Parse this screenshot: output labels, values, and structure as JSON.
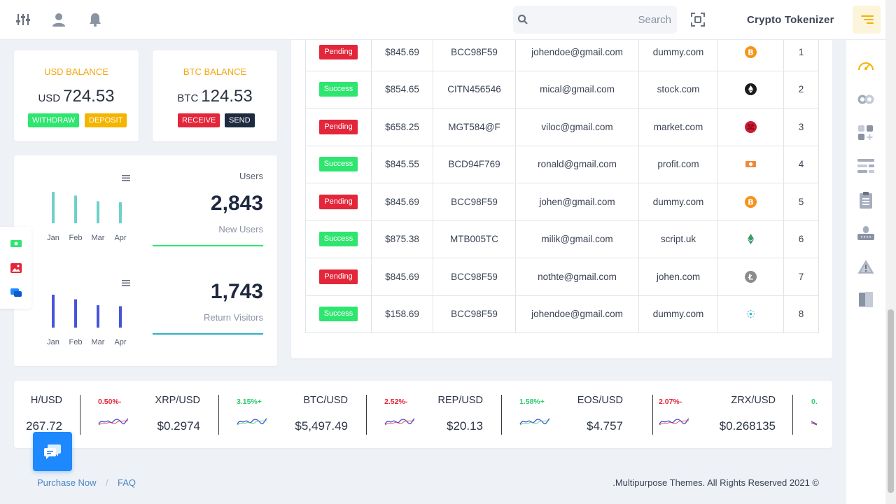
{
  "header": {
    "brand": "Crypto Tokenizer",
    "search_placeholder": "Search",
    "icons": [
      "sliders-icon",
      "user-icon",
      "bell-icon",
      "scan-icon",
      "hamburger-icon"
    ]
  },
  "balances": {
    "usd": {
      "title": "USD BALANCE",
      "currency": "USD",
      "amount": "724.53",
      "btn1": "WITHDRAW",
      "btn2": "DEPOSIT"
    },
    "btc": {
      "title": "BTC BALANCE",
      "currency": "BTC",
      "amount": "124.53",
      "btn1": "RECEIVE",
      "btn2": "SEND"
    }
  },
  "stats": {
    "users_label": "Users",
    "new_users_value": "2,843",
    "new_users_label": "New Users",
    "return_value": "1,743",
    "return_label": "Return Visitors"
  },
  "chart_data": [
    {
      "type": "bar",
      "categories": [
        "Jan",
        "Feb",
        "Mar",
        "Apr"
      ],
      "values": [
        100,
        88,
        70,
        67
      ],
      "ylim": [
        0,
        100
      ],
      "color": "#6fd0cb"
    },
    {
      "type": "bar",
      "categories": [
        "Jan",
        "Feb",
        "Mar",
        "Apr"
      ],
      "values": [
        100,
        86,
        68,
        65
      ],
      "ylim": [
        0,
        100
      ],
      "color": "#4755d8"
    }
  ],
  "transactions": [
    {
      "status": "Pending",
      "amount": "$845.69",
      "id": "BCC98F59",
      "email": "johendoe@gmail.com",
      "site": "dummy.com",
      "coin": "bitcoin-icon",
      "no": "1"
    },
    {
      "status": "Success",
      "amount": "$854.65",
      "id": "CITN456546",
      "email": "mical@gmail.com",
      "site": "stock.com",
      "coin": "ethereum-icon",
      "no": "2"
    },
    {
      "status": "Pending",
      "amount": "$658.25",
      "id": "MGT584@F",
      "email": "viloc@gmail.com",
      "site": "market.com",
      "coin": "raspberry-coin-icon",
      "no": "3"
    },
    {
      "status": "Success",
      "amount": "$845.55",
      "id": "BCD94F769",
      "email": "ronald@gmail.com",
      "site": "profit.com",
      "coin": "cash-coin-icon",
      "no": "4"
    },
    {
      "status": "Pending",
      "amount": "$845.69",
      "id": "BCC98F59",
      "email": "johen@gmail.com",
      "site": "dummy.com",
      "coin": "bitcoin-icon",
      "no": "5"
    },
    {
      "status": "Success",
      "amount": "$875.38",
      "id": "MTB005TC",
      "email": "milik@gmail.com",
      "site": "script.uk",
      "coin": "ethereum-green-icon",
      "no": "6"
    },
    {
      "status": "Pending",
      "amount": "$845.69",
      "id": "BCC98F59",
      "email": "nothte@gmail.com",
      "site": "johen.com",
      "coin": "litecoin-icon",
      "no": "7"
    },
    {
      "status": "Success",
      "amount": "$158.69",
      "id": "BCC98F59",
      "email": "johendoe@gmail.com",
      "site": "dummy.com",
      "coin": "cardano-icon",
      "no": "8"
    }
  ],
  "ticker": [
    {
      "pair": "H/USD",
      "price": "267.72",
      "pct": ""
    },
    {
      "pair": "XRP/USD",
      "price": "$0.2974",
      "pct": "0.50%-"
    },
    {
      "pair": "BTC/USD",
      "price": "$5,497.49",
      "pct": "3.15%+"
    },
    {
      "pair": "REP/USD",
      "price": "$20.13",
      "pct": "2.52%-"
    },
    {
      "pair": "EOS/USD",
      "price": "$4.757",
      "pct": "1.58%+"
    },
    {
      "pair": "ZRX/USD",
      "price": "$0.268135",
      "pct": "2.07%-"
    },
    {
      "pair": "",
      "price": "",
      "pct": "0."
    }
  ],
  "footer": {
    "link1": "Purchase Now",
    "sep": "/",
    "link2": "FAQ",
    "copyright": ".Multipurpose Themes. All Rights Reserved 2021 ©"
  },
  "colors": {
    "pending": "#e3263a",
    "success": "#2ee66f",
    "accent": "#f4a60c",
    "blue": "#1e88ff",
    "navy": "#1d2a3f"
  }
}
